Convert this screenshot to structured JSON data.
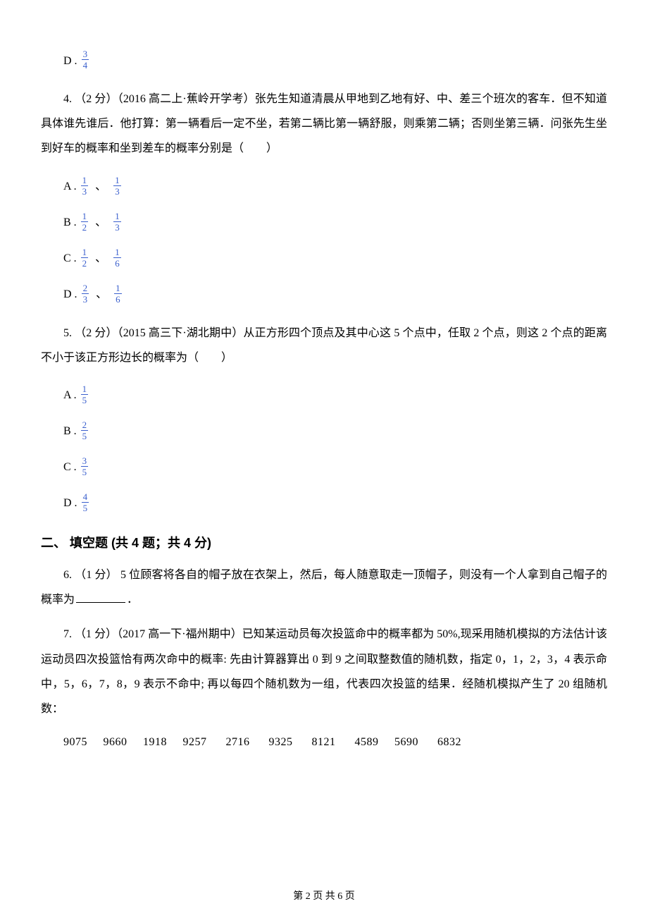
{
  "q3": {
    "optD": {
      "label": "D .",
      "num": "3",
      "den": "4"
    }
  },
  "q4": {
    "stem": "4. （2 分）（2016 高二上·蕉岭开学考）张先生知道清晨从甲地到乙地有好、中、差三个班次的客车．但不知道具体谁先谁后．他打算：第一辆看后一定不坐，若第二辆比第一辆舒服，则乘第二辆；否则坐第三辆．问张先生坐到好车的概率和坐到差车的概率分别是（　　）",
    "optA": {
      "label": "A .",
      "n1": "1",
      "d1": "3",
      "sep": "、",
      "n2": "1",
      "d2": "3"
    },
    "optB": {
      "label": "B .",
      "n1": "1",
      "d1": "2",
      "sep": "、",
      "n2": "1",
      "d2": "3"
    },
    "optC": {
      "label": "C .",
      "n1": "1",
      "d1": "2",
      "sep": "、",
      "n2": "1",
      "d2": "6"
    },
    "optD": {
      "label": "D .",
      "n1": "2",
      "d1": "3",
      "sep": "、",
      "n2": "1",
      "d2": "6"
    }
  },
  "q5": {
    "stem": "5. （2 分）（2015 高三下·湖北期中）从正方形四个顶点及其中心这 5 个点中，任取 2 个点，则这 2 个点的距离不小于该正方形边长的概率为（　　）",
    "optA": {
      "label": "A .",
      "num": "1",
      "den": "5"
    },
    "optB": {
      "label": "B .",
      "num": "2",
      "den": "5"
    },
    "optC": {
      "label": "C .",
      "num": "3",
      "den": "5"
    },
    "optD": {
      "label": "D .",
      "num": "4",
      "den": "5"
    }
  },
  "section2": "二、 填空题 (共 4 题；共 4 分)",
  "q6": {
    "before": "6. （1 分） 5 位顾客将各自的帽子放在衣架上，然后，每人随意取走一顶帽子，则没有一个人拿到自己帽子的概率为",
    "after": "．"
  },
  "q7": {
    "stem": "7. （1 分）（2017 高一下·福州期中）已知某运动员每次投篮命中的概率都为 50%,现采用随机模拟的方法估计该运动员四次投篮恰有两次命中的概率: 先由计算器算出 0 到 9 之间取整数值的随机数，指定 0，1，2，3，4 表示命中，5，6，7，8，9 表示不命中; 再以每四个随机数为一组，代表四次投篮的结果．经随机模拟产生了 20 组随机数：",
    "row": "9075     9660     1918     9257      2716      9325      8121      4589     5690      6832"
  },
  "footer": "第 2 页 共 6 页"
}
